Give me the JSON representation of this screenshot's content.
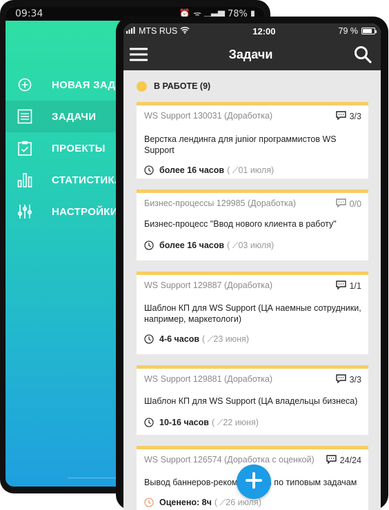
{
  "android": {
    "status_time": "09:34",
    "status_battery": "78%",
    "menu": [
      {
        "label": "НОВАЯ ЗАДАЧА",
        "icon": "plus-circle-icon"
      },
      {
        "label": "ЗАДАЧИ",
        "icon": "list-icon"
      },
      {
        "label": "ПРОЕКТЫ",
        "icon": "clipboard-check-icon"
      },
      {
        "label": "СТАТИСТИКА",
        "icon": "bar-chart-icon"
      },
      {
        "label": "НАСТРОЙКИ",
        "icon": "sliders-icon"
      }
    ]
  },
  "ios": {
    "carrier": "MTS RUS",
    "time": "12:00",
    "battery": "79 %"
  },
  "appbar": {
    "title": "Задачи"
  },
  "section": {
    "title": "В РАБОТЕ (9)"
  },
  "tasks": [
    {
      "project": "WS Support 130031 (Доработка)",
      "comments": "3/3",
      "name": "Верстка лендинга для junior программистов WS Support",
      "duration": "более 16 часов",
      "date": "01 июля"
    },
    {
      "project": "Бизнес-процессы 129985 (Доработка)",
      "comments": "0/0",
      "name": "Бизнес-процесс \"Ввод нового клиента в работу\"",
      "duration": "более 16 часов",
      "date": "03 июля"
    },
    {
      "project": "WS Support 129887 (Доработка)",
      "comments": "1/1",
      "name": "Шаблон КП для WS Support (ЦА наемные сотрудники, например, маркетологи)",
      "duration": "4-6 часов",
      "date": "23 июня"
    },
    {
      "project": "WS Support 129881 (Доработка)",
      "comments": "3/3",
      "name": "Шаблон КП для WS Support (ЦА владельцы бизнеса)",
      "duration": "10-16 часов",
      "date": "22 июня"
    },
    {
      "project": "WS Support 126574 (Доработка с оценкой)",
      "comments": "24/24",
      "name": "Вывод баннеров-рекомендаций по типовым задачам",
      "duration": "Оценено: 8ч",
      "date": "26 июля"
    }
  ],
  "colors": {
    "accent": "#f7cd63",
    "fab": "#1c9ce6",
    "gradient_top": "#2fe0a2",
    "gradient_bottom": "#1f9fde"
  }
}
